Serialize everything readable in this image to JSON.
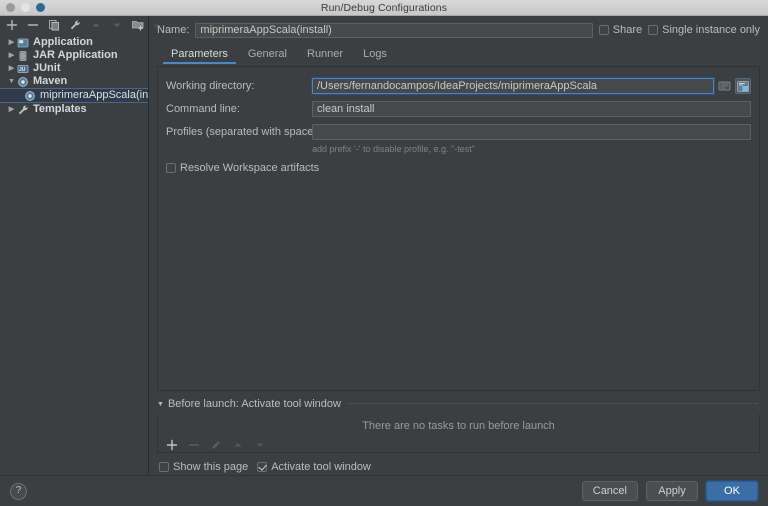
{
  "titlebar": {
    "title": "Run/Debug Configurations",
    "buttons": [
      "close",
      "minimize",
      "zoom"
    ]
  },
  "left_toolbar": {
    "items": [
      {
        "name": "add-icon",
        "glyph": "+"
      },
      {
        "name": "remove-icon",
        "glyph": "−"
      },
      {
        "name": "copy-icon",
        "glyph": "copy"
      },
      {
        "name": "edit-templates-icon",
        "glyph": "wrench"
      },
      {
        "name": "move-up-icon",
        "glyph": "▲"
      },
      {
        "name": "move-down-icon",
        "glyph": "▼"
      },
      {
        "name": "add-folder-icon",
        "glyph": "folder-plus"
      },
      {
        "name": "expand-more-icon",
        "glyph": "»"
      }
    ]
  },
  "tree": {
    "items": [
      {
        "label": "Application",
        "icon": "application-icon",
        "expanded": false,
        "selected": false,
        "child": false
      },
      {
        "label": "JAR Application",
        "icon": "jar-icon",
        "expanded": false,
        "selected": false,
        "child": false
      },
      {
        "label": "JUnit",
        "icon": "junit-icon",
        "expanded": false,
        "selected": false,
        "child": false
      },
      {
        "label": "Maven",
        "icon": "maven-icon",
        "expanded": true,
        "selected": false,
        "child": false
      },
      {
        "label": "miprimeraAppScala(install)",
        "icon": "maven-icon",
        "expanded": null,
        "selected": true,
        "child": true
      },
      {
        "label": "Templates",
        "icon": "templates-icon",
        "expanded": false,
        "selected": false,
        "child": false
      }
    ]
  },
  "name_row": {
    "label": "Name:",
    "value": "miprimeraAppScala(install)",
    "placeholder": "",
    "share": {
      "label": "Share",
      "checked": false
    },
    "single_instance": {
      "label": "Single instance only",
      "checked": false
    }
  },
  "tabs": [
    {
      "label": "Parameters",
      "active": true
    },
    {
      "label": "General",
      "active": false
    },
    {
      "label": "Runner",
      "active": false
    },
    {
      "label": "Logs",
      "active": false
    }
  ],
  "parameters": {
    "working_directory": {
      "label": "Working directory:",
      "value": "/Users/fernandocampos/IdeaProjects/miprimeraAppScala",
      "placeholder": "",
      "focused": true,
      "browse_icon": "browse-folder-icon",
      "macro_icon": "insert-macro-icon"
    },
    "command_line": {
      "label": "Command line:",
      "value": "clean install",
      "placeholder": ""
    },
    "profiles": {
      "label": "Profiles (separated with space):",
      "value": "",
      "placeholder": "",
      "hint": "add prefix '-' to disable profile, e.g. \"-test\""
    },
    "resolve_workspace_artifacts": {
      "label": "Resolve Workspace artifacts",
      "checked": false
    }
  },
  "before_launch": {
    "title": "Before launch: Activate tool window",
    "empty_text": "There are no tasks to run before launch",
    "toolbar": [
      {
        "name": "add-task-icon",
        "glyph": "+",
        "enabled": true
      },
      {
        "name": "remove-task-icon",
        "glyph": "−",
        "enabled": false
      },
      {
        "name": "edit-task-icon",
        "glyph": "pencil",
        "enabled": false
      },
      {
        "name": "move-task-up-icon",
        "glyph": "▲",
        "enabled": false
      },
      {
        "name": "move-task-down-icon",
        "glyph": "▼",
        "enabled": false
      }
    ],
    "show_this_page": {
      "label": "Show this page",
      "checked": false
    },
    "activate_tool_window": {
      "label": "Activate tool window",
      "checked": true
    }
  },
  "footer": {
    "help_label": "?",
    "cancel_label": "Cancel",
    "apply_label": "Apply",
    "ok_label": "OK"
  },
  "colors": {
    "accent": "#4a88c7",
    "primary_button": "#3b6ea5",
    "window_bg": "#3c3f41",
    "field_bg": "#45494a",
    "selection_bg": "#2f3a4a"
  }
}
